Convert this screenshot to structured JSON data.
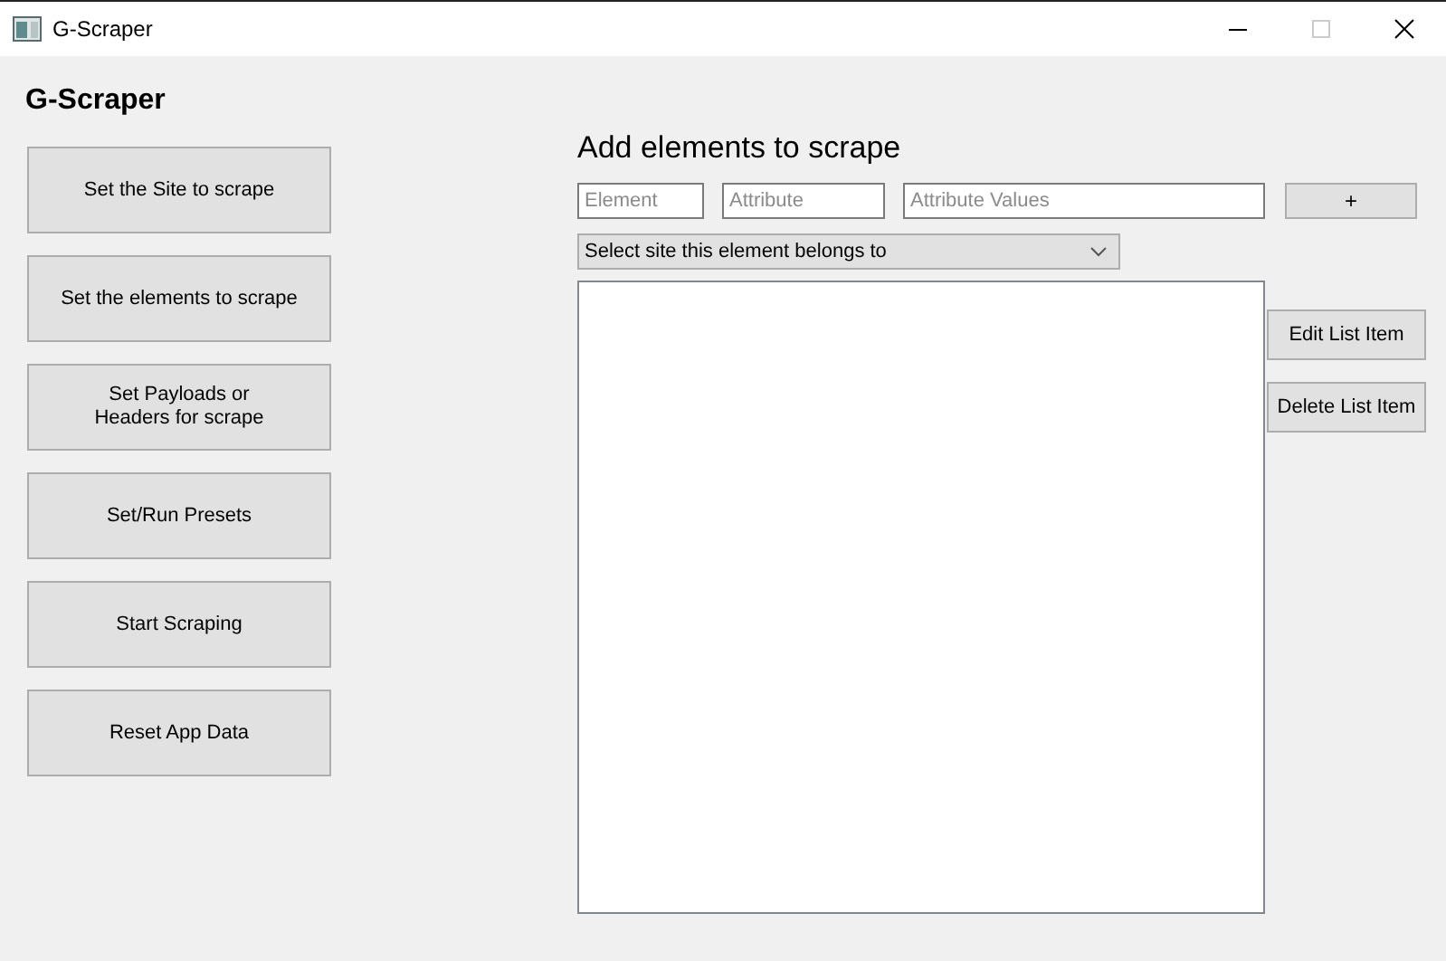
{
  "window": {
    "title": "G-Scraper",
    "maximize_disabled": true
  },
  "app_title": "G-Scraper",
  "nav_buttons": [
    "Set the Site to scrape",
    "Set the elements to scrape",
    "Set Payloads or\nHeaders for scrape",
    "Set/Run Presets",
    "Start Scraping",
    "Reset App Data"
  ],
  "panel": {
    "title": "Add elements to scrape",
    "fields": [
      {
        "placeholder": "Element"
      },
      {
        "placeholder": "Attribute"
      },
      {
        "placeholder": "Attribute Values"
      }
    ],
    "add_button": "+",
    "site_select": {
      "value": "Select site this element belongs to"
    },
    "list_buttons": [
      "Edit List Item",
      "Delete List Item"
    ]
  }
}
